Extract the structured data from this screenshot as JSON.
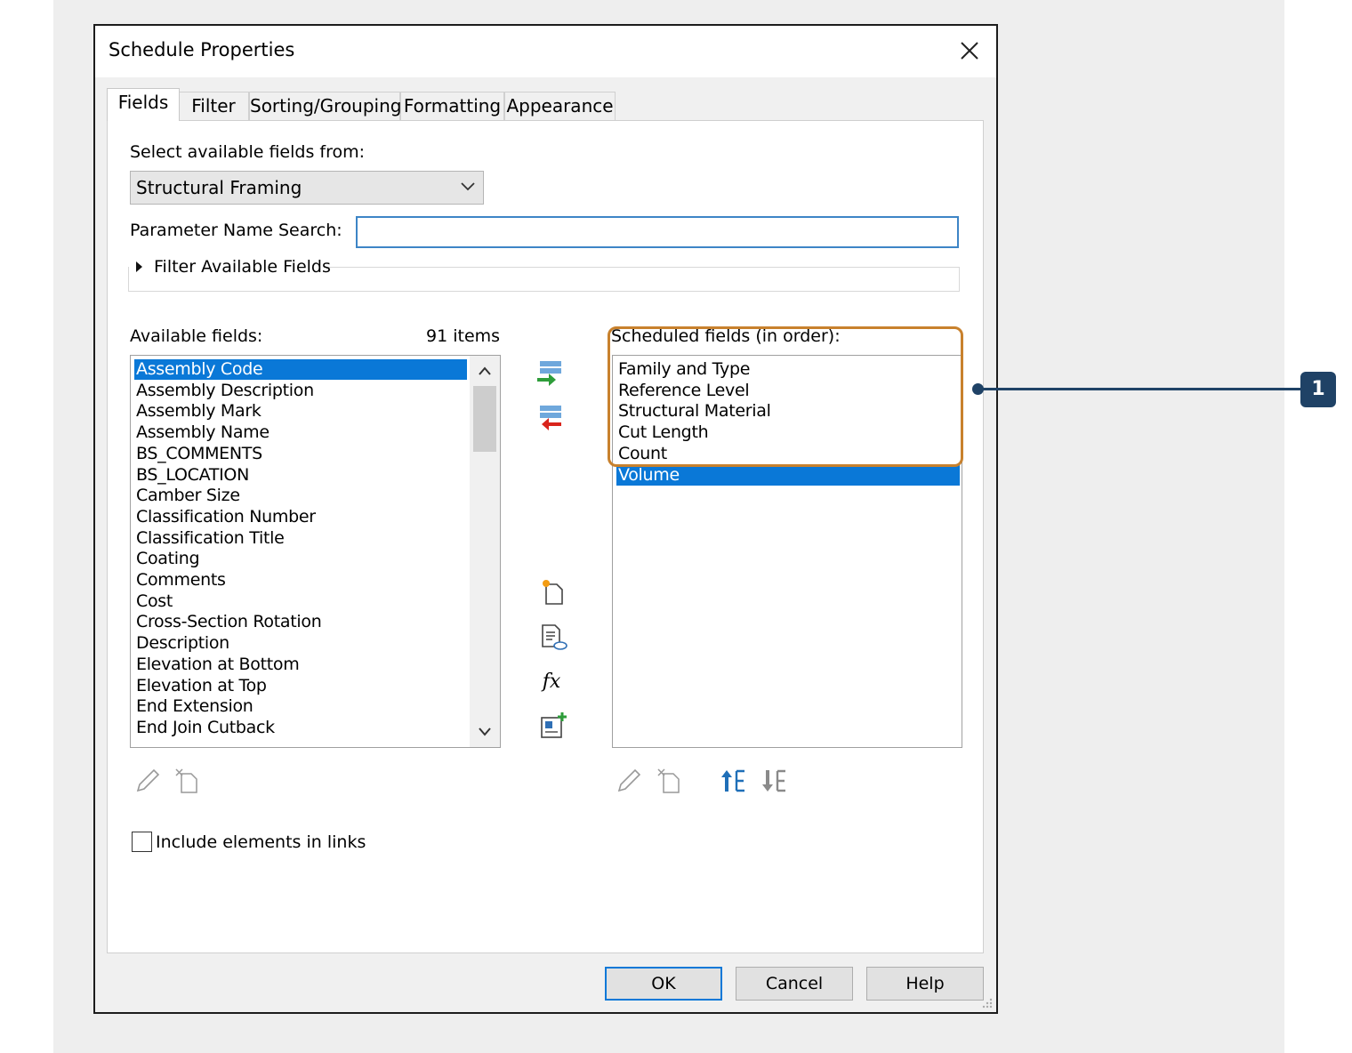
{
  "dialog": {
    "title": "Schedule Properties"
  },
  "tabs": [
    {
      "label": "Fields",
      "active": true
    },
    {
      "label": "Filter",
      "active": false
    },
    {
      "label": "Sorting/Grouping",
      "active": false
    },
    {
      "label": "Formatting",
      "active": false
    },
    {
      "label": "Appearance",
      "active": false
    }
  ],
  "fields_tab": {
    "select_from_label": "Select available fields from:",
    "category_selected": "Structural Framing",
    "param_search_label": "Parameter Name Search:",
    "param_search_value": "",
    "filter_available_label": "Filter Available Fields",
    "available_label": "Available fields:",
    "available_count": "91 items",
    "available_fields": [
      "Assembly Code",
      "Assembly Description",
      "Assembly Mark",
      "Assembly Name",
      "BS_COMMENTS",
      "BS_LOCATION",
      "Camber Size",
      "Classification Number",
      "Classification Title",
      "Coating",
      "Comments",
      "Cost",
      "Cross-Section Rotation",
      "Description",
      "Elevation at Bottom",
      "Elevation at Top",
      "End Extension",
      "End Join Cutback"
    ],
    "available_selected": "Assembly Code",
    "scheduled_label": "Scheduled fields (in order):",
    "scheduled_fields": [
      "Family and Type",
      "Reference Level",
      "Structural Material",
      "Cut Length",
      "Count",
      "Volume"
    ],
    "scheduled_selected": "Volume",
    "include_links_label": "Include elements in links",
    "include_links_checked": false
  },
  "buttons": {
    "ok": "OK",
    "cancel": "Cancel",
    "help": "Help"
  },
  "callout": {
    "number": "1"
  },
  "colors": {
    "selection": "#0a78d7",
    "highlight_border": "#c8812d",
    "callout": "#1f4266"
  }
}
